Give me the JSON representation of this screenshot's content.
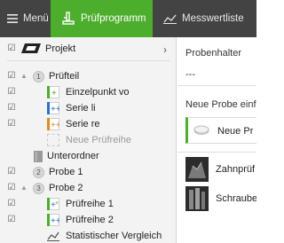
{
  "topbar": {
    "menu_label": "Menü",
    "pruefprogramm_label": "Prüfprogramm",
    "messwertliste_label": "Messwertliste"
  },
  "tree": {
    "project_label": "Projekt",
    "pruefteil": {
      "badge": "1",
      "label": "Prüfteil"
    },
    "einzelpunkt": "Einzelpunkt vo",
    "serie_li": "Serie li",
    "serie_re": "Serie re",
    "neue_pruefreihe": "Neue Prüfreihe",
    "unterordner": "Unterordner",
    "probe1": {
      "badge": "2",
      "label": "Probe 1"
    },
    "probe2": {
      "badge": "3",
      "label": "Probe 2"
    },
    "pruefreihe1": "Prüfreihe 1",
    "pruefreihe2": "Prüfreihe 2",
    "statistik": "Statistischer Vergleich"
  },
  "right": {
    "probenhalter_label": "Probenhalter",
    "probenhalter_value": "---",
    "neue_probe_label": "Neue Probe einfüg",
    "neue_probe_item": "Neue Pr",
    "card1_label": "Zahnprüf",
    "card2_label": "Schraube"
  },
  "colors": {
    "accent_green": "#4cae2c",
    "topbar_bg": "#434343",
    "tree_bg": "#f3f3f3"
  }
}
